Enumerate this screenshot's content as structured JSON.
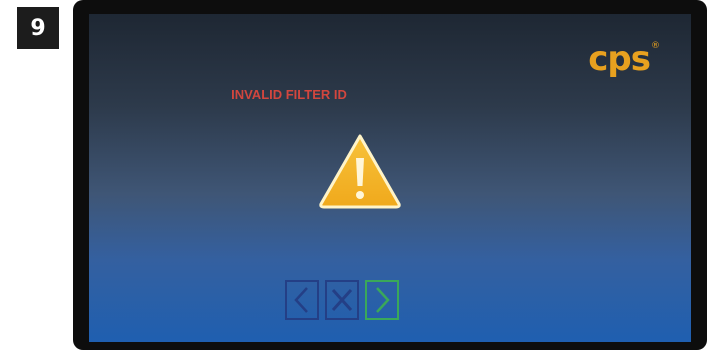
{
  "step": {
    "number": "9"
  },
  "brand": {
    "logo_text": "cps",
    "registered_mark": "®",
    "color": "#e8a11f"
  },
  "screen": {
    "error_message": "INVALID FILTER ID",
    "error_color": "#d2463e",
    "alert_icon": "warning-triangle-icon"
  },
  "navigation": {
    "back_icon": "chevron-left-icon",
    "cancel_icon": "close-icon",
    "next_icon": "chevron-right-icon",
    "back_color": "#243f86",
    "next_color": "#3aa85a"
  }
}
